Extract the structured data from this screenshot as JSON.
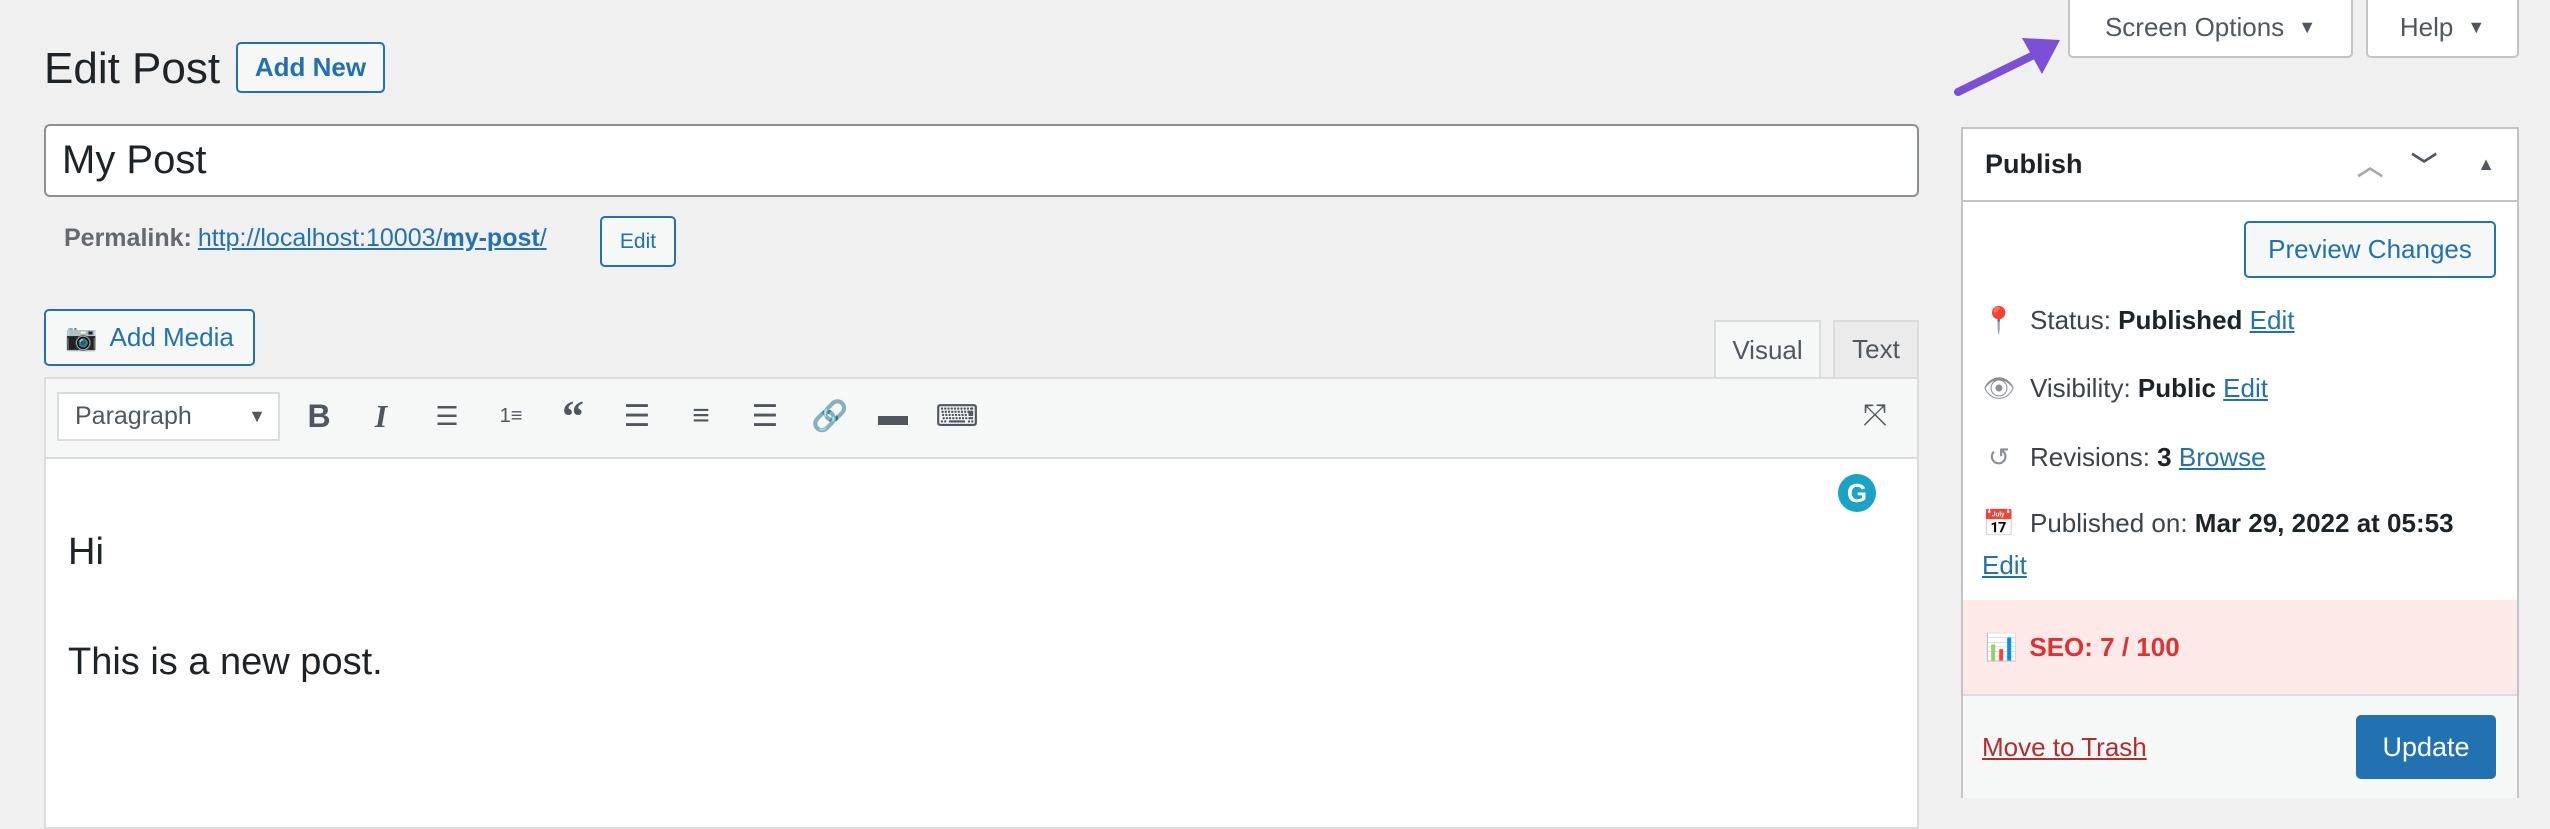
{
  "header": {
    "title": "Edit Post",
    "add_new": "Add New",
    "screen_options": "Screen Options",
    "help": "Help"
  },
  "post": {
    "title": "My Post",
    "permalink_label": "Permalink:",
    "permalink_base": "http://localhost:10003/",
    "permalink_slug": "my-post",
    "permalink_end": "/",
    "permalink_edit": "Edit"
  },
  "editor": {
    "add_media": "Add Media",
    "tabs": [
      "Visual",
      "Text"
    ],
    "format_select": "Paragraph",
    "content": [
      "Hi",
      "This is a new post."
    ]
  },
  "publish": {
    "title": "Publish",
    "preview": "Preview Changes",
    "status_label": "Status:",
    "status_value": "Published",
    "status_edit": "Edit",
    "visibility_label": "Visibility:",
    "visibility_value": "Public",
    "visibility_edit": "Edit",
    "revisions_label": "Revisions:",
    "revisions_value": "3",
    "revisions_browse": "Browse",
    "published_label": "Published on:",
    "published_value": "Mar 29, 2022 at 05:53",
    "published_edit": "Edit",
    "seo": "SEO: 7 / 100",
    "trash": "Move to Trash",
    "update": "Update"
  },
  "colors": {
    "accent": "#2271b1",
    "seo_bad": "#dc3232",
    "seo_bg": "#fde9e8",
    "arrow": "#7b4fd6"
  }
}
